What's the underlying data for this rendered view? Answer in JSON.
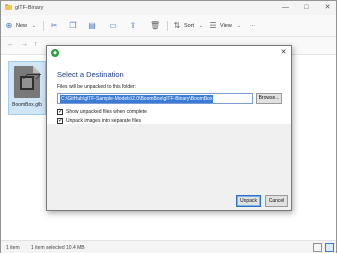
{
  "window": {
    "title": "glTF-Binary",
    "controls": [
      "—",
      "□",
      "✕"
    ]
  },
  "toolbar": {
    "new_label": "New",
    "sort_label": "Sort",
    "view_label": "View",
    "more_label": "···"
  },
  "file": {
    "name": "BoomBox.glb"
  },
  "status": {
    "items": "1 item",
    "selected": "1 item selected  10.4 MB"
  },
  "dialog": {
    "heading": "Select a Destination",
    "label": "Files will be unpacked to this folder:",
    "path_value": "C:\\GitHub\\glTF-Sample-Models\\2.0\\BoomBox\\glTF-Binary\\BoomBox",
    "browse_label": "Browse...",
    "check_show": "Show unpacked files when complete",
    "check_unpack": "Unpack images into separate files",
    "unpack_label": "Unpack",
    "cancel_label": "Cancel"
  }
}
